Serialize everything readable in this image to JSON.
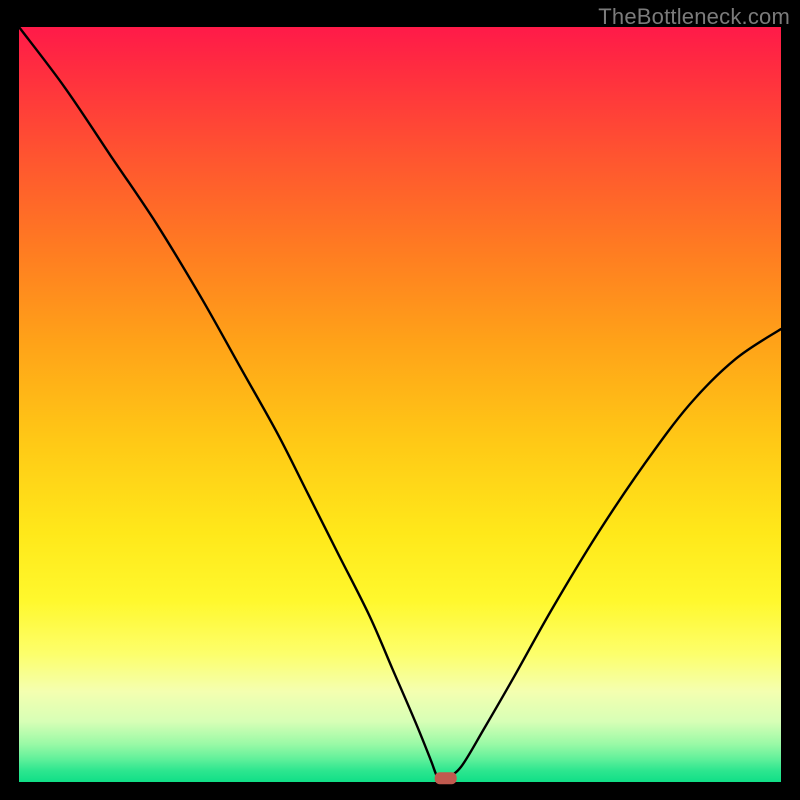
{
  "watermark": {
    "text": "TheBottleneck.com"
  },
  "colors": {
    "background": "#000000",
    "curve": "#000000",
    "marker": "#c05a4f",
    "gradient_stops": [
      "#ff1a49",
      "#ff2e3f",
      "#ff5430",
      "#ff7a22",
      "#ffa318",
      "#ffc916",
      "#ffe81a",
      "#fff82d",
      "#fdff6b",
      "#f4ffb0",
      "#d7ffb6",
      "#99f9a6",
      "#5ff09a",
      "#2de68f",
      "#10df87"
    ]
  },
  "chart_data": {
    "type": "line",
    "title": "",
    "xlabel": "",
    "ylabel": "",
    "xlim": [
      0,
      100
    ],
    "ylim": [
      0,
      100
    ],
    "grid": false,
    "legend": null,
    "description": "Single asymmetric V-shaped bottleneck curve descending from top-left, reaching ~0 near x≈56, then rising toward the right edge to ~60.",
    "marker": {
      "x": 56,
      "y": 0.5,
      "shape": "rounded-rect"
    },
    "series": [
      {
        "name": "bottleneck-curve",
        "x": [
          0,
          6,
          12,
          18,
          24,
          29,
          34,
          38,
          42,
          46,
          49,
          52,
          54,
          55,
          56,
          58,
          61,
          65,
          70,
          76,
          82,
          88,
          94,
          100
        ],
        "y": [
          100,
          92,
          83,
          74,
          64,
          55,
          46,
          38,
          30,
          22,
          15,
          8,
          3,
          0.5,
          0.5,
          2,
          7,
          14,
          23,
          33,
          42,
          50,
          56,
          60
        ]
      }
    ]
  }
}
